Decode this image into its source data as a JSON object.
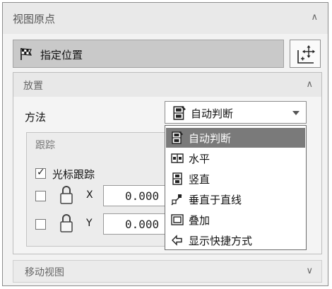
{
  "panel": {
    "title": "视图原点",
    "specify_location_label": "指定位置"
  },
  "placement": {
    "title": "放置",
    "method_label": "方法",
    "method_selected": "自动判断",
    "method_options": [
      "自动判断",
      "水平",
      "竖直",
      "垂直于直线",
      "叠加",
      "显示快捷方式"
    ],
    "tracking": {
      "title": "跟踪",
      "cursor_tracking_label": "光标跟踪",
      "cursor_tracking_checked": true,
      "x_label": "X",
      "x_value": "0.000",
      "y_label": "Y",
      "y_value": "0.000"
    }
  },
  "move_view": {
    "title": "移动视图"
  },
  "icons": {
    "specify_location": "checkered-flag-icon",
    "move_button": "move-origin-icon",
    "lock": "padlock-icon"
  }
}
